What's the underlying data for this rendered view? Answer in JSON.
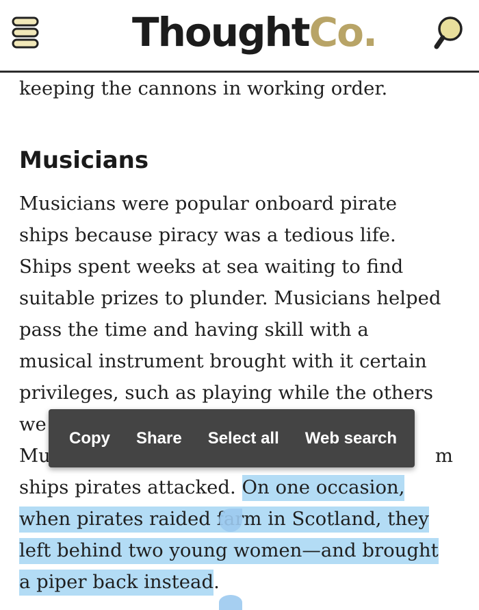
{
  "header": {
    "logo_primary": "Thought",
    "logo_secondary": "Co.",
    "menu_icon": "hamburger-icon",
    "search_icon": "search-icon",
    "colors": {
      "logo_text": "#1c1c1c",
      "logo_accent": "#b8a467",
      "search_fill": "#e9df9c"
    }
  },
  "article": {
    "intro_line": "keeping the cannons in working order.",
    "section_title": "Musicians",
    "lines": [
      "Musicians were popular onboard pirate",
      "ships because piracy was a tedious life.",
      "Ships spent weeks at sea waiting to find",
      "suitable prizes to plunder. Musicians helped",
      "pass the time and having skill with a",
      "musical instrument brought with it certain",
      "privileges, such as playing while the others"
    ],
    "partial_line_1": "we",
    "partial_line_2_start": "Mu",
    "partial_line_2_end": "m",
    "line_9_plain": "ships pirates attacked. ",
    "line_9_selected": "On one occasion,",
    "line_10_selected_a": "when pirates raided ",
    "line_10_selected_b": "farm in Scotland, they",
    "line_11_selected": "left behind two young women—and brought",
    "line_12_selected": "a piper back instead",
    "line_12_plain": "."
  },
  "selection_toolbar": {
    "copy": "Copy",
    "share": "Share",
    "select_all": "Select all",
    "web_search": "Web search"
  },
  "colors": {
    "selection_highlight": "#b3dcf5",
    "selection_handle": "#9ccaef",
    "toolbar_bg": "#444444"
  }
}
